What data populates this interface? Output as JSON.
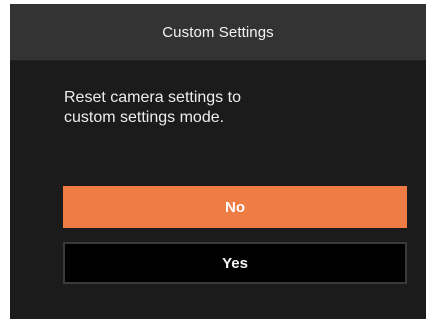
{
  "dialog": {
    "title": "Custom Settings",
    "message": "Reset camera settings to\ncustom settings mode."
  },
  "buttons": {
    "no_label": "No",
    "yes_label": "Yes"
  },
  "colors": {
    "dialog_background": "#1b1b1b",
    "title_bar": "#333333",
    "selected_button": "#ef7b45",
    "unselected_button": "#000000"
  }
}
